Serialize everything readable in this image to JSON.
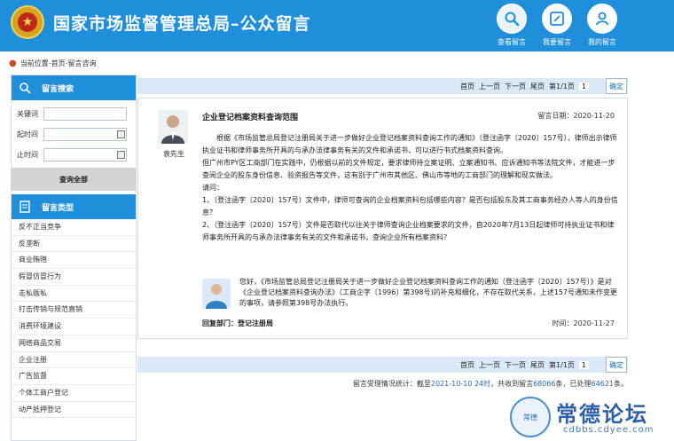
{
  "header": {
    "title": "国家市场监督管理总局–公众留言",
    "nav": [
      {
        "label": "查看留言",
        "icon": "search-icon"
      },
      {
        "label": "我要留言",
        "icon": "compose-icon"
      },
      {
        "label": "我的留言",
        "icon": "user-icon"
      }
    ]
  },
  "breadcrumb": {
    "text": "当前位置-首页-留言咨询"
  },
  "sidebar": {
    "search_title": "留言搜索",
    "fields": {
      "keyword": "关键词",
      "start": "起时间",
      "end": "止时间"
    },
    "query_all": "查询全部",
    "categories_title": "留言类型",
    "categories": [
      "反不正当竞争",
      "反垄断",
      "商业贿赂",
      "假冒仿冒行为",
      "走私贩私",
      "打击传销与规范直销",
      "消费环境建设",
      "网络商品交易",
      "企业注册",
      "广告监督",
      "个体工商户登记",
      "动产抵押登记"
    ]
  },
  "pager": {
    "first": "首页",
    "prev": "上一页",
    "next": "下一页",
    "last": "尾页",
    "info": "第1/1页",
    "page": "1",
    "confirm": "确定"
  },
  "message": {
    "asker": "袁先生",
    "title": "企业登记档案资料查询范围",
    "date": "留言日期：2020-11-20",
    "body": [
      "根据《市场监管总局登记注册局关于进一步做好企业登记档案资料查询工作的通知》（登注函字〔2020〕157号），律师出示律师执业证书和律师事务所开具的与承办法律事务有关的文件和承诺书，可以进行书式档案资料查询。",
      "但广州市PY区工商部门在实践中，仍根据以前的文件规定，要求律师持立案证明、立案通知书、应诉通知书等法院文件，才能进一步查阅企业的股东身份信息、验资报告等文件，这有别于广州市其他区、佛山市等地的工商部门的理解和现实做法。",
      "请问：",
      "1、（登注函字〔2020〕157号）文件中，律师可查询的企业档案资料包括哪些内容？是否包括股东及其工商事务经办人等人的身份信息？",
      "2、（登注函字〔2020〕157号）文件是否取代以往关于律师查询企业档案要求的文件，自2020年7月13日起律师可持执业证书和律师事务所开具的与承办法律事务有关的文件和承诺书，查询企业所有档案资料？"
    ]
  },
  "reply": {
    "text": "您好，《市场监管总局登记注册局关于进一步做好企业登记档案资料查询工作的通知（登注函字〔2020〕157号）》是对《企业登记档案资料查询办法》（工商企字〔1996〕第398号)的补充和细化，不存在取代关系，上述157号通知未作变更的事项，请参照第398号办法执行。",
    "dept": "回复部门：登记注册局",
    "time": "时间：2020-11-27"
  },
  "stats": {
    "prefix": "留言受理情况统计：截至",
    "date": "2021-10-10 24时",
    "mid1": "，共收到留言",
    "received": "68066",
    "mid2": "条，已处理",
    "processed": "64621",
    "suffix": "条。"
  },
  "watermark": {
    "seal": "常德",
    "text": "常德论坛",
    "url": "cdbbs.cdyee.com"
  },
  "colors": {
    "primary": "#1f8fdc",
    "pager_bg": "#dbe9f6",
    "link": "#1f6fb6"
  }
}
